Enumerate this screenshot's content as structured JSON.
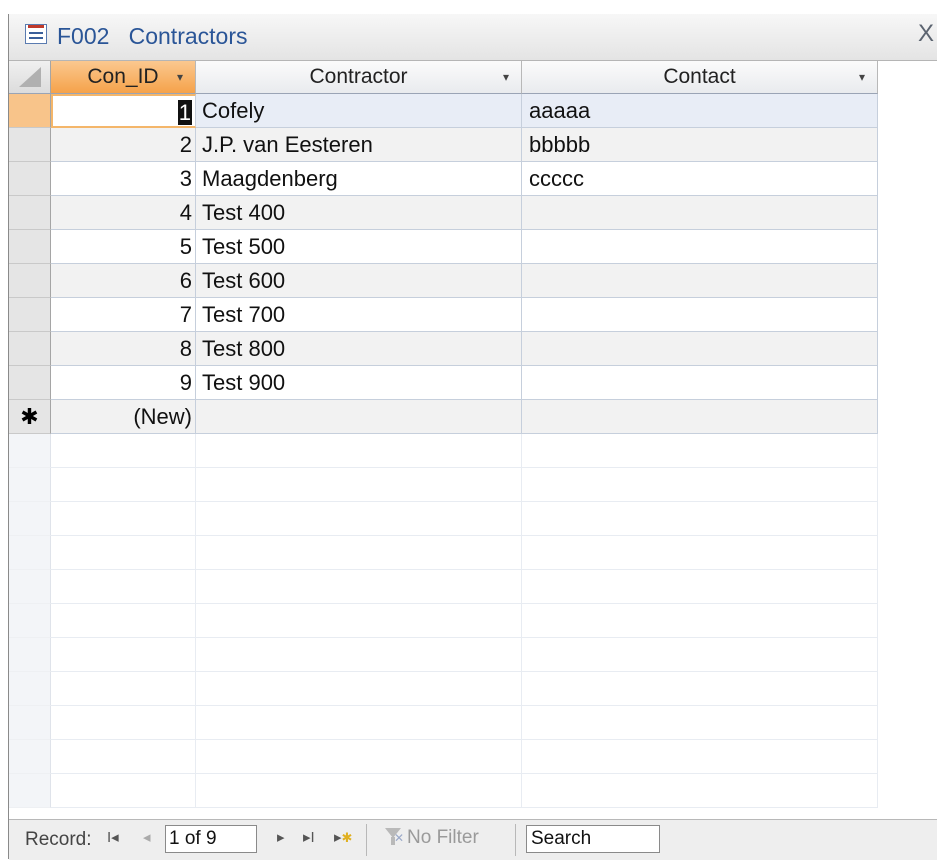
{
  "window": {
    "form_code": "F002",
    "title": "Contractors",
    "close_symbol": "X"
  },
  "columns": [
    {
      "label": "Con_ID",
      "dropdown": "▾"
    },
    {
      "label": "Contractor",
      "dropdown": "▾"
    },
    {
      "label": "Contact",
      "dropdown": "▾"
    }
  ],
  "rows": [
    {
      "id": "1",
      "contractor": "Cofely",
      "contact": "aaaaa"
    },
    {
      "id": "2",
      "contractor": "J.P. van Eesteren",
      "contact": "bbbbb"
    },
    {
      "id": "3",
      "contractor": "Maagdenberg",
      "contact": "ccccc"
    },
    {
      "id": "4",
      "contractor": "Test 400",
      "contact": ""
    },
    {
      "id": "5",
      "contractor": "Test 500",
      "contact": ""
    },
    {
      "id": "6",
      "contractor": "Test 600",
      "contact": ""
    },
    {
      "id": "7",
      "contractor": "Test 700",
      "contact": ""
    },
    {
      "id": "8",
      "contractor": "Test 800",
      "contact": ""
    },
    {
      "id": "9",
      "contractor": "Test 900",
      "contact": ""
    }
  ],
  "new_row": {
    "marker": "✱",
    "label": "(New)"
  },
  "navigation": {
    "record_label": "Record:",
    "first": "I◂",
    "previous": "◂",
    "current": "1 of 9",
    "next": "▸",
    "last": "▸I",
    "new_record": "▸",
    "filter_label": "No Filter",
    "search_label": "Search"
  },
  "colors": {
    "title_text": "#2a5597",
    "selected_header": "#f5a24a",
    "current_row_selector": "#f8c48a"
  }
}
